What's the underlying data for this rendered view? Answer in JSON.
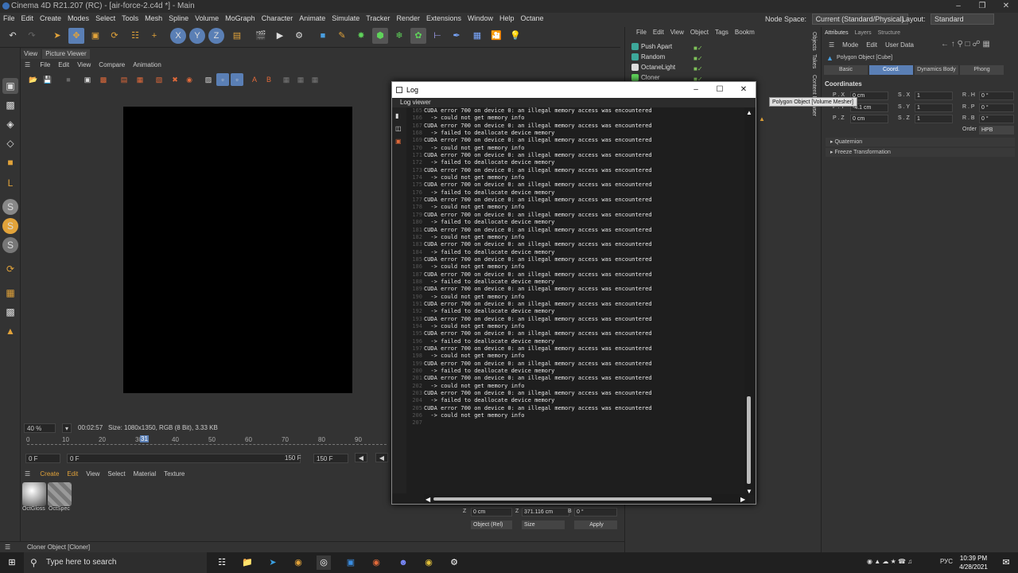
{
  "window": {
    "title": "Cinema 4D R21.207 (RC) - [air-force-2.c4d *] - Main"
  },
  "menu": [
    "File",
    "Edit",
    "Create",
    "Modes",
    "Select",
    "Tools",
    "Mesh",
    "Spline",
    "Volume",
    "MoGraph",
    "Character",
    "Animate",
    "Simulate",
    "Tracker",
    "Render",
    "Extensions",
    "Window",
    "Help",
    "Octane"
  ],
  "nodespace": {
    "label": "Node Space:",
    "value": "Current (Standard/Physical)",
    "layout_label": "Layout:",
    "layout_value": "Standard"
  },
  "toolbar_icons": [
    "undo-icon",
    "redo-icon",
    "select-icon",
    "move-icon",
    "scale-icon",
    "rotate-icon",
    "recent-icon",
    "add-icon",
    "x-axis-icon",
    "y-axis-icon",
    "z-axis-icon",
    "coord-system-icon",
    "render-region-icon",
    "render-view-icon",
    "render-settings-icon",
    "cube-icon",
    "pen-icon",
    "subdivision-icon",
    "generator-icon",
    "cloner-icon",
    "field-icon",
    "deformer-icon",
    "camera-icon",
    "scene-icon",
    "light-icon"
  ],
  "picture_viewer": {
    "tabs": [
      "View",
      "Picture Viewer"
    ],
    "menu": [
      "File",
      "Edit",
      "View",
      "Compare",
      "Animation"
    ],
    "zoom": "40 %",
    "time": "00:02:57",
    "info": "Size: 1080x1350, RGB (8 Bit), 3.33 KB"
  },
  "timeline": {
    "ticks": [
      "0",
      "10",
      "20",
      "30",
      "40",
      "50",
      "60",
      "70",
      "80",
      "90"
    ],
    "current": "31",
    "start": "0 F",
    "start2": "0 F",
    "end": "150 F",
    "end2": "150 F"
  },
  "material": {
    "menu": [
      "Create",
      "Edit",
      "View",
      "Select",
      "Material",
      "Texture"
    ],
    "items": [
      "OctGloss",
      "OctSpec"
    ]
  },
  "status": "Cloner Object [Cloner]",
  "objects": {
    "menu": [
      "File",
      "Edit",
      "View",
      "Object",
      "Tags",
      "Bookm"
    ],
    "rows": [
      "Push Apart",
      "Random",
      "OctaneLight",
      "Cloner"
    ]
  },
  "side_tabs": [
    "Objects",
    "Takes",
    "Content Browser"
  ],
  "attributes": {
    "top": [
      "Attributes",
      "Layers",
      "Structure"
    ],
    "menu": [
      "Mode",
      "Edit",
      "User Data"
    ],
    "object": "Polygon Object [Cube]",
    "tabs": [
      "Basic",
      "Coord.",
      "Dynamics Body",
      "Phong"
    ],
    "section": "Coordinates",
    "rows": [
      {
        "p": "P . X",
        "pv": "0 cm",
        "s": "S . X",
        "sv": "1",
        "r": "R . H",
        "rv": "0 °"
      },
      {
        "p": "P . Y",
        "pv": "-4.1 cm",
        "s": "S . Y",
        "sv": "1",
        "r": "R . P",
        "rv": "0 °"
      },
      {
        "p": "P . Z",
        "pv": "0 cm",
        "s": "S . Z",
        "sv": "1",
        "r": "R . B",
        "rv": "0 °"
      }
    ],
    "order_label": "Order",
    "order": "HPB",
    "folds": [
      "Quaternion",
      "Freeze Transformation"
    ]
  },
  "tooltip": "Polygon Object [Volume Mesher]",
  "log": {
    "title": "Log",
    "header": "Log viewer",
    "lines": [
      {
        "n": "165",
        "t": "CUDA error 700 on device 0: an illegal memory access was encountered"
      },
      {
        "n": "166",
        "t": "  -> could not get memory info"
      },
      {
        "n": "167",
        "t": "CUDA error 700 on device 0: an illegal memory access was encountered"
      },
      {
        "n": "168",
        "t": "  -> failed to deallocate device memory"
      },
      {
        "n": "169",
        "t": "CUDA error 700 on device 0: an illegal memory access was encountered"
      },
      {
        "n": "170",
        "t": "  -> could not get memory info"
      },
      {
        "n": "171",
        "t": "CUDA error 700 on device 0: an illegal memory access was encountered"
      },
      {
        "n": "172",
        "t": "  -> failed to deallocate device memory"
      },
      {
        "n": "173",
        "t": "CUDA error 700 on device 0: an illegal memory access was encountered"
      },
      {
        "n": "174",
        "t": "  -> could not get memory info"
      },
      {
        "n": "175",
        "t": "CUDA error 700 on device 0: an illegal memory access was encountered"
      },
      {
        "n": "176",
        "t": "  -> failed to deallocate device memory"
      },
      {
        "n": "177",
        "t": "CUDA error 700 on device 0: an illegal memory access was encountered"
      },
      {
        "n": "178",
        "t": "  -> could not get memory info"
      },
      {
        "n": "179",
        "t": "CUDA error 700 on device 0: an illegal memory access was encountered"
      },
      {
        "n": "180",
        "t": "  -> failed to deallocate device memory"
      },
      {
        "n": "181",
        "t": "CUDA error 700 on device 0: an illegal memory access was encountered"
      },
      {
        "n": "182",
        "t": "  -> could not get memory info"
      },
      {
        "n": "183",
        "t": "CUDA error 700 on device 0: an illegal memory access was encountered"
      },
      {
        "n": "184",
        "t": "  -> failed to deallocate device memory"
      },
      {
        "n": "185",
        "t": "CUDA error 700 on device 0: an illegal memory access was encountered"
      },
      {
        "n": "186",
        "t": "  -> could not get memory info"
      },
      {
        "n": "187",
        "t": "CUDA error 700 on device 0: an illegal memory access was encountered"
      },
      {
        "n": "188",
        "t": "  -> failed to deallocate device memory"
      },
      {
        "n": "189",
        "t": "CUDA error 700 on device 0: an illegal memory access was encountered"
      },
      {
        "n": "190",
        "t": "  -> could not get memory info"
      },
      {
        "n": "191",
        "t": "CUDA error 700 on device 0: an illegal memory access was encountered"
      },
      {
        "n": "192",
        "t": "  -> failed to deallocate device memory"
      },
      {
        "n": "193",
        "t": "CUDA error 700 on device 0: an illegal memory access was encountered"
      },
      {
        "n": "194",
        "t": "  -> could not get memory info"
      },
      {
        "n": "195",
        "t": "CUDA error 700 on device 0: an illegal memory access was encountered"
      },
      {
        "n": "196",
        "t": "  -> failed to deallocate device memory"
      },
      {
        "n": "197",
        "t": "CUDA error 700 on device 0: an illegal memory access was encountered"
      },
      {
        "n": "198",
        "t": "  -> could not get memory info"
      },
      {
        "n": "199",
        "t": "CUDA error 700 on device 0: an illegal memory access was encountered"
      },
      {
        "n": "200",
        "t": "  -> failed to deallocate device memory"
      },
      {
        "n": "201",
        "t": "CUDA error 700 on device 0: an illegal memory access was encountered"
      },
      {
        "n": "202",
        "t": "  -> could not get memory info"
      },
      {
        "n": "203",
        "t": "CUDA error 700 on device 0: an illegal memory access was encountered"
      },
      {
        "n": "204",
        "t": "  -> failed to deallocate device memory"
      },
      {
        "n": "205",
        "t": "CUDA error 700 on device 0: an illegal memory access was encountered"
      },
      {
        "n": "206",
        "t": "  -> could not get memory info"
      },
      {
        "n": "207",
        "t": ""
      }
    ]
  },
  "coords_bottom": {
    "z_label": "Z",
    "z": "0 cm",
    "z2_label": "Z",
    "z2": "371.116 cm",
    "b_label": "B",
    "b": "0 °",
    "mode": "Object (Rel)",
    "size": "Size",
    "apply": "Apply"
  },
  "taskbar": {
    "search": "Type here to search",
    "time": "10:39 PM",
    "date": "4/28/2021",
    "lang": "РУС"
  }
}
